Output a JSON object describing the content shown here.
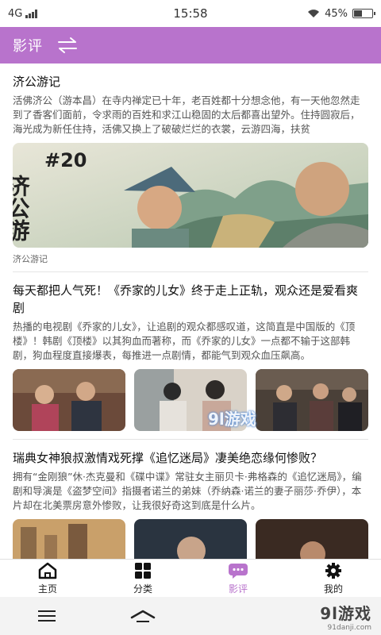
{
  "status_bar": {
    "network": "4G",
    "time": "15:58",
    "battery": "45%",
    "battery_level": 0.45
  },
  "header": {
    "title": "影评",
    "switch_icon": "swap-arrows-icon"
  },
  "articles": [
    {
      "title": "济公游记",
      "summary": "活佛济公（游本昌）在寺内禅定已十年，老百姓都十分想念他，有一天他忽然走到了香客们面前，令求雨的百姓和求江山稳固的太后都喜出望外。住持圆寂后，海光成为新任住持，活佛又换上了破破烂烂的衣裳，云游四海，扶贫",
      "image_text": "济公游",
      "image_episode": "#20",
      "caption": "济公游记"
    },
    {
      "title": "每天都把人气死！《乔家的儿女》终于走上正轨，观众还是爱看爽剧",
      "summary": "热播的电视剧《乔家的儿女》，让追剧的观众都感叹道，这简直是中国版的《顶楼》！韩剧《顶楼》以其狗血而著称，而《乔家的儿女》一点都不输于这部韩剧，狗血程度直接爆表，每推进一点剧情，都能气到观众血压飙高。"
    },
    {
      "title": "瑞典女神狼叔激情戏死撑《追忆迷局》凄美绝恋缘何惨败？",
      "summary": "拥有“金刚狼”休·杰克曼和《碟中谍》常驻女主丽贝卡·弗格森的《追忆迷局》，编剧和导演是《盗梦空间》指摄者诺兰的弟妹（乔纳森·诺兰的妻子丽莎·乔伊），本片却在北美票房意外惨败，让我很好奇这到底是什么片。"
    }
  ],
  "overlay_watermark": "9l游戏",
  "tabs": [
    {
      "label": "主页",
      "icon": "home-icon",
      "active": false
    },
    {
      "label": "分类",
      "icon": "grid-icon",
      "active": false
    },
    {
      "label": "影评",
      "icon": "chat-bubble-icon",
      "active": true
    },
    {
      "label": "我的",
      "icon": "gear-icon",
      "active": false
    }
  ],
  "system_nav": {
    "menu_icon": "menu-icon",
    "home_icon": "home-chevron-icon"
  },
  "watermark": {
    "main": "9l游戏",
    "sub": "91danji.com"
  },
  "colors": {
    "accent": "#b873cc"
  }
}
